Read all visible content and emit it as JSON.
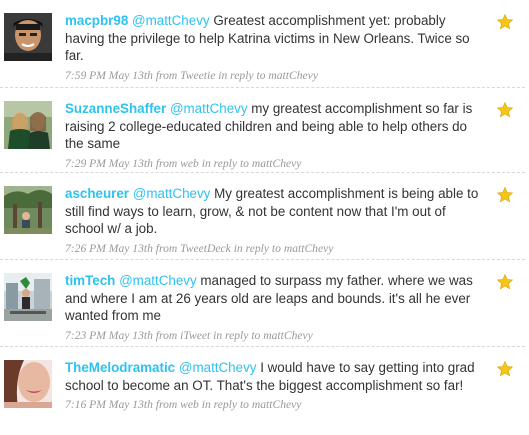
{
  "colors": {
    "link": "#2fc2ef",
    "text": "#333333",
    "meta": "#999999",
    "star": "#f5c518"
  },
  "tweets": [
    {
      "screen_name": "macpbr98",
      "mention": "@mattChevy",
      "text": " Greatest accomplishment yet: probably having the privilege to help Katrina victims in New Orleans. Twice so far.",
      "meta": "7:59 PM May 13th from Tweetie in reply to mattChevy",
      "avatar_icon": "user-photo-icon",
      "favorite_icon": "star-icon"
    },
    {
      "screen_name": "SuzanneShaffer",
      "mention": "@mattChevy",
      "text": " my greatest accomplishment so far is raising 2 college-educated children and being able to help others do the same",
      "meta": "7:29 PM May 13th from web in reply to mattChevy",
      "avatar_icon": "user-photo-icon",
      "favorite_icon": "star-icon"
    },
    {
      "screen_name": "ascheurer",
      "mention": "@mattChevy",
      "text": " My greatest accomplishment is being able to still find ways to learn, grow, & not be content now that I'm out of school w/ a job.",
      "meta": "7:26 PM May 13th from TweetDeck in reply to mattChevy",
      "avatar_icon": "user-photo-icon",
      "favorite_icon": "star-icon"
    },
    {
      "screen_name": "timTech",
      "mention": "@mattChevy",
      "text": " managed to surpass my father. where we was and where I am at 26 years old are leaps and bounds. it's all he ever wanted from me",
      "meta": "7:23 PM May 13th from iTweet in reply to mattChevy",
      "avatar_icon": "user-photo-icon",
      "favorite_icon": "star-icon"
    },
    {
      "screen_name": "TheMelodramatic",
      "mention": "@mattChevy",
      "text": " I would have to say getting into grad school to become an OT. That's the biggest accomplishment so far!",
      "meta": "7:16 PM May 13th from web in reply to mattChevy",
      "avatar_icon": "user-photo-icon",
      "favorite_icon": "star-icon"
    }
  ]
}
